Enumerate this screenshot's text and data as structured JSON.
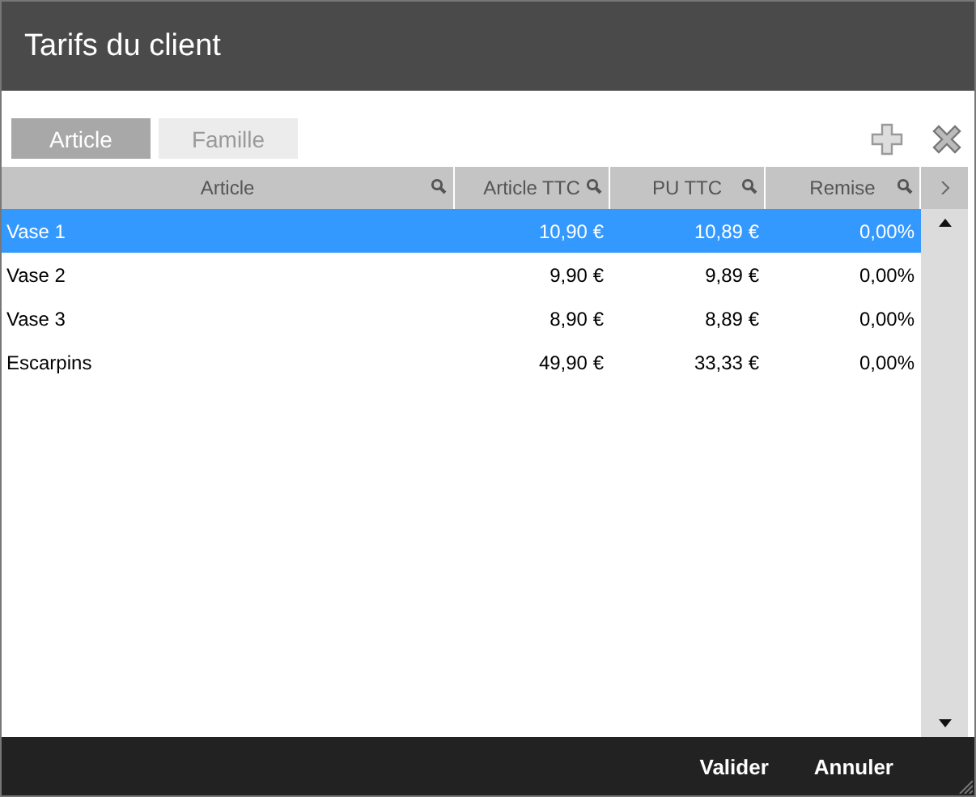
{
  "window": {
    "title": "Tarifs du client"
  },
  "tabs": [
    {
      "label": "Article",
      "selected": true
    },
    {
      "label": "Famille",
      "selected": false
    }
  ],
  "table": {
    "columns": [
      "Article",
      "Article TTC",
      "PU TTC",
      "Remise"
    ],
    "rows": [
      {
        "cells": [
          "Vase 1",
          "10,90 €",
          "10,89 €",
          "0,00%"
        ],
        "selected": true
      },
      {
        "cells": [
          "Vase 2",
          "9,90 €",
          "9,89 €",
          "0,00%"
        ],
        "selected": false
      },
      {
        "cells": [
          "Vase 3",
          "8,90 €",
          "8,89 €",
          "0,00%"
        ],
        "selected": false
      },
      {
        "cells": [
          "Escarpins",
          "49,90 €",
          "33,33 €",
          "0,00%"
        ],
        "selected": false
      }
    ]
  },
  "buttons": [
    "Valider",
    "Annuler"
  ]
}
